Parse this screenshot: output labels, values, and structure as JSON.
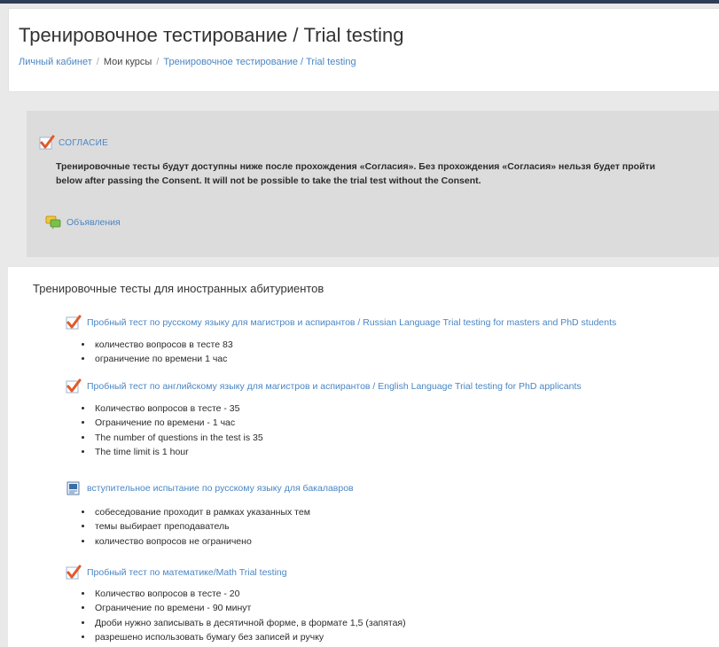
{
  "header": {
    "title": "Тренировочное тестирование / Trial testing",
    "breadcrumb": {
      "home": "Личный кабинет",
      "my_courses": "Мои курсы",
      "current": "Тренировочное тестирование / Trial testing"
    }
  },
  "consent": {
    "link": "СОГЛАСИЕ",
    "text": "Тренировочные тесты будут доступны ниже после прохождения «Согласия». Без прохождения «Согласия» нельзя будет пройти\nbelow after passing the Consent. It will not be possible to take the trial test without the Consent.",
    "announcements_link": "Объявления"
  },
  "section": {
    "title": "Тренировочные тесты для иностранных абитуриентов",
    "activities": [
      {
        "icon": "quiz-checkmark-icon",
        "title": "Пробный тест по русскому языку для магистров и аспирантов / Russian Language Trial testing for masters and PhD students",
        "bullets": [
          "количество вопросов в тесте 83",
          "ограничение по времени 1 час"
        ]
      },
      {
        "icon": "quiz-checkmark-icon",
        "title": "Пробный тест по английскому языку для магистров и аспирантов / English Language Trial testing for PhD applicants",
        "bullets": [
          "Количество вопросов в тесте - 35",
          "Ограничение по времени - 1 час",
          "The number of questions in the test is 35",
          "The time limit is 1 hour"
        ]
      },
      {
        "icon": "assignment-icon",
        "title": "вступительное испытание по русскому языку для бакалавров",
        "bullets": [
          "собеседование проходит в рамках указанных тем",
          "темы выбирает преподаватель",
          "количество вопросов не ограничено"
        ]
      },
      {
        "icon": "quiz-checkmark-icon",
        "title": "Пробный тест по математике/Math Trial testing",
        "bullets": [
          "Количество вопросов в тесте - 20",
          "Ограничение по времени - 90 минут",
          "Дроби нужно записывать в десятичной форме, в формате 1,5 (запятая)",
          "разрешено использовать бумагу без записей и ручку"
        ]
      }
    ]
  },
  "colors": {
    "link": "#4a86c4",
    "checkmark": "#e05a2b",
    "topbar": "#2f3e57"
  }
}
